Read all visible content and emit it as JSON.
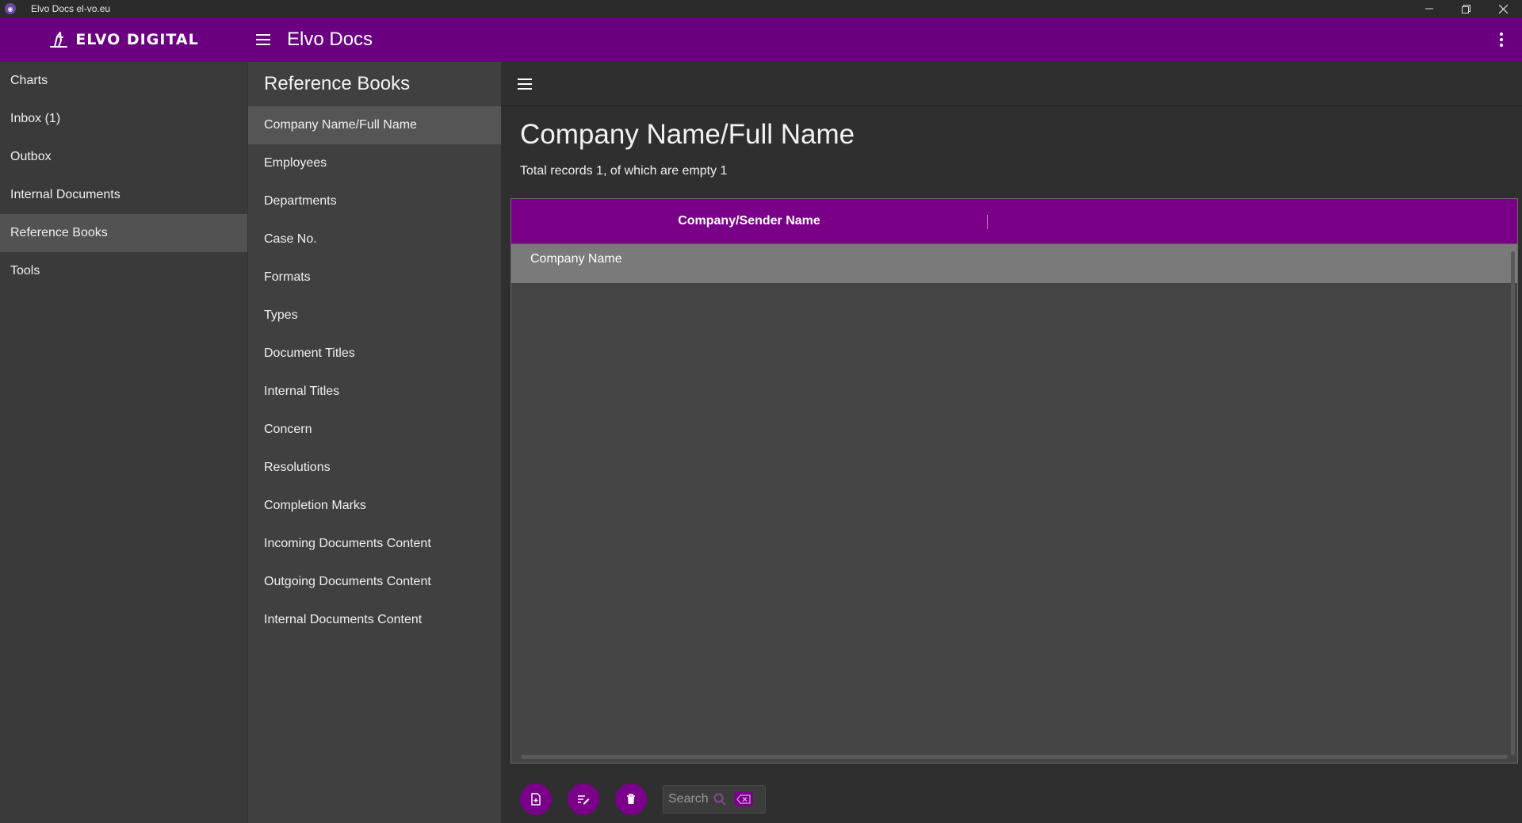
{
  "window": {
    "title": "Elvo Docs el-vo.eu",
    "app_icon": "app-logo-icon",
    "controls": [
      "minimize",
      "restore",
      "close"
    ]
  },
  "appbar": {
    "logo_text": "ELVO DIGITAL",
    "title": "Elvo Docs",
    "color": "#6a0080"
  },
  "nav": {
    "items": [
      {
        "label": "Charts"
      },
      {
        "label": "Inbox (1)"
      },
      {
        "label": "Outbox"
      },
      {
        "label": "Internal Documents"
      },
      {
        "label": "Reference Books",
        "active": true
      },
      {
        "label": "Tools"
      }
    ]
  },
  "reference_books": {
    "heading": "Reference Books",
    "items": [
      {
        "label": "Company Name/Full Name",
        "active": true
      },
      {
        "label": "Employees"
      },
      {
        "label": "Departments"
      },
      {
        "label": "Case No."
      },
      {
        "label": "Formats"
      },
      {
        "label": "Types"
      },
      {
        "label": "Document Titles"
      },
      {
        "label": "Internal Titles"
      },
      {
        "label": "Concern"
      },
      {
        "label": "Resolutions"
      },
      {
        "label": "Completion Marks"
      },
      {
        "label": "Incoming Documents Content"
      },
      {
        "label": "Outgoing Documents Content"
      },
      {
        "label": "Internal Documents Content"
      }
    ]
  },
  "main": {
    "title": "Company Name/Full Name",
    "subtitle": "Total records 1, of which are empty 1",
    "table": {
      "columns": [
        "Company/Sender Name"
      ],
      "rows": [
        [
          "Company Name"
        ]
      ]
    },
    "search_placeholder": "Search",
    "accent": "#7b0089"
  }
}
